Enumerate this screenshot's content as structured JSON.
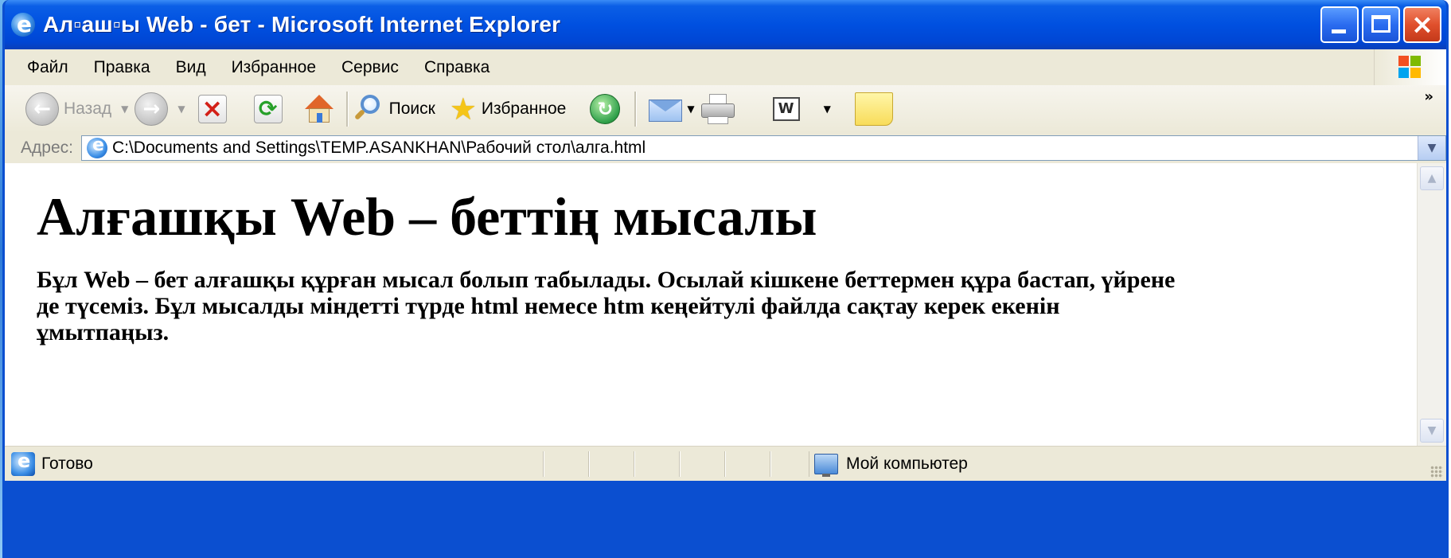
{
  "window": {
    "title": "Ал▫аш▫ы Web - бет - Microsoft Internet Explorer"
  },
  "menu": {
    "items": [
      "Файл",
      "Правка",
      "Вид",
      "Избранное",
      "Сервис",
      "Справка"
    ]
  },
  "toolbar": {
    "back_label": "Назад",
    "search_label": "Поиск",
    "favorites_label": "Избранное"
  },
  "address": {
    "label": "Адрес:",
    "url": "C:\\Documents and Settings\\TEMP.ASANKHAN\\Рабочий стол\\алга.html"
  },
  "page": {
    "heading": "Алғашқы Web – беттің мысалы",
    "paragraph": "Бұл Web – бет алғашқы құрған мысал болып табылады. Осылай кішкене беттермен құра бастап, үйрене де түсеміз. Бұл мысалды міндетті түрде html немесе htm кеңейтулі файлда сақтау керек екенін ұмытпаңыз."
  },
  "status": {
    "text": "Готово",
    "zone": "Мой компьютер"
  },
  "colors": {
    "titlebar": "#0050e0",
    "chrome": "#ece9d8",
    "close_button": "#e0502c"
  }
}
